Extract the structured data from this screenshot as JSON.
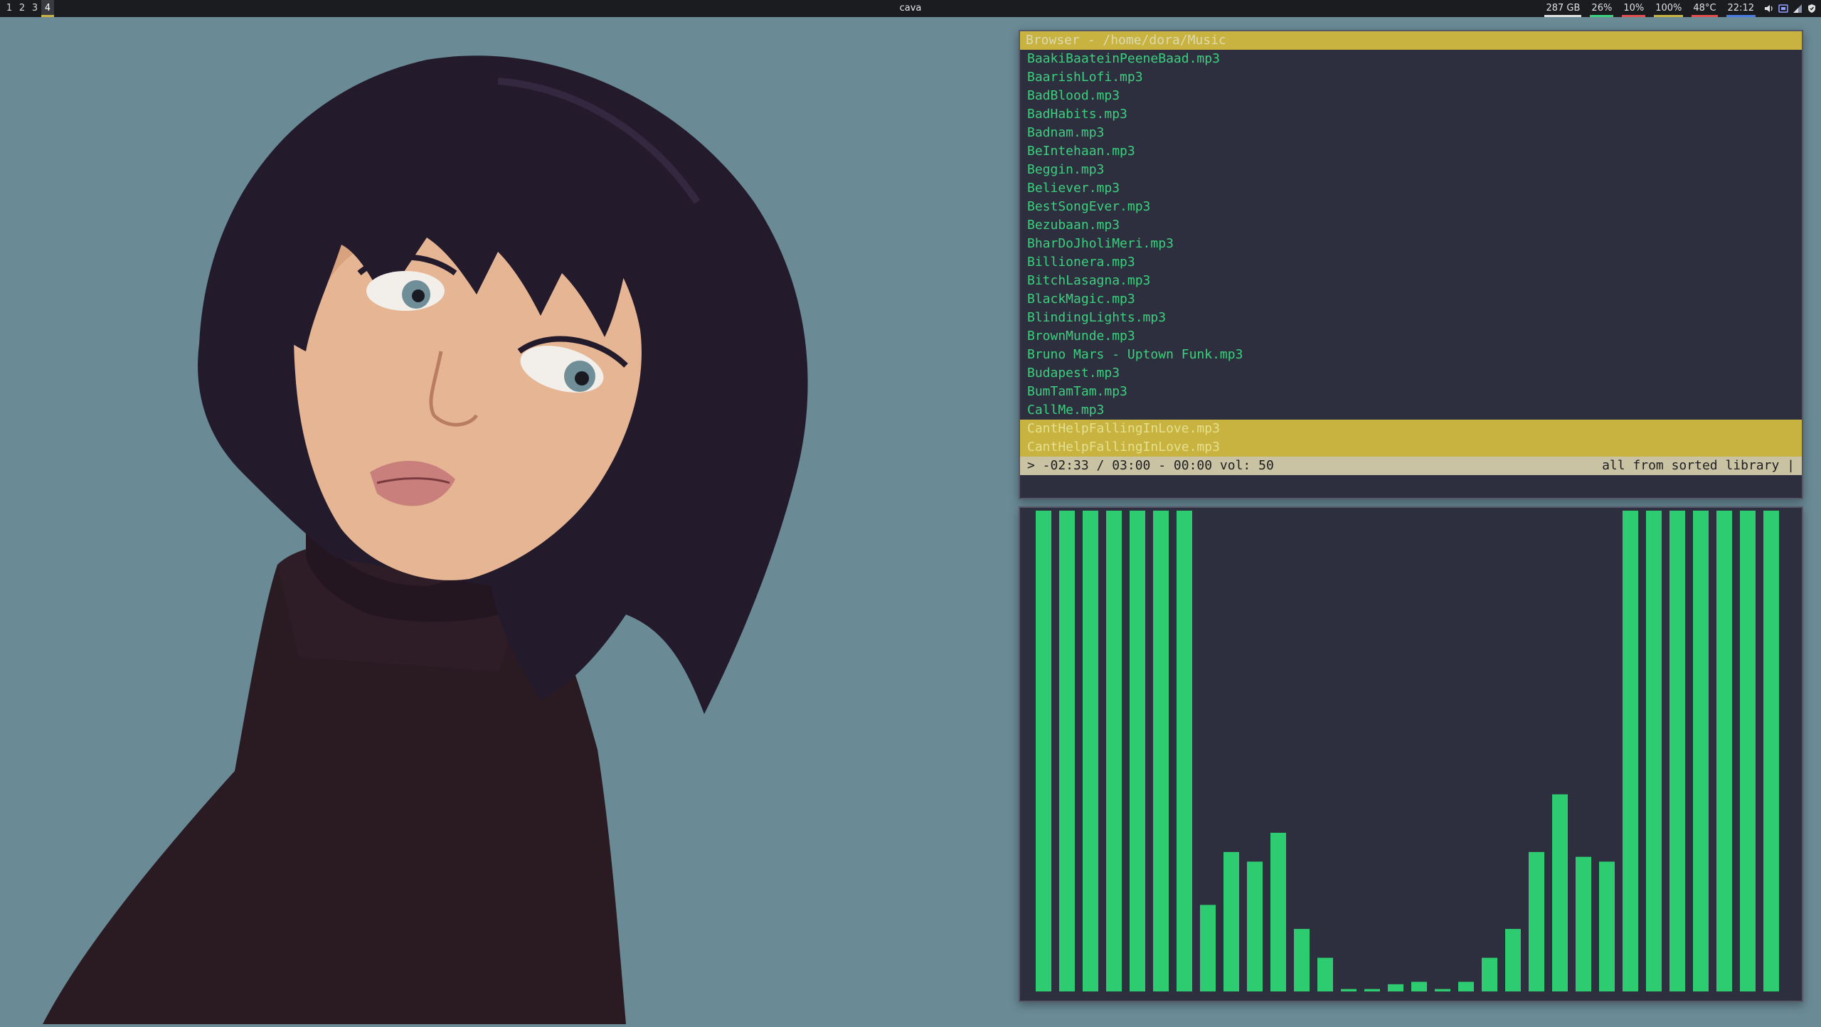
{
  "topbar": {
    "workspaces": [
      "1",
      "2",
      "3",
      "4"
    ],
    "active_workspace": "4",
    "window_title": "cava",
    "status": [
      {
        "label": "287 GB",
        "color": "#e0e0e0"
      },
      {
        "label": "26%",
        "color": "#3bd07e"
      },
      {
        "label": "10%",
        "color": "#e05050"
      },
      {
        "label": "100%",
        "color": "#c8b341"
      },
      {
        "label": "48°C",
        "color": "#e05050"
      },
      {
        "label": "22:12",
        "color": "#4a7be0"
      }
    ],
    "tray_icons": [
      "volume-icon",
      "network-icon",
      "signal-icon",
      "shield-icon"
    ]
  },
  "browser": {
    "title": "Browser - /home/dora/Music",
    "tracks": [
      "BaakiBaateinPeeneBaad.mp3",
      "BaarishLofi.mp3",
      "BadBlood.mp3",
      "BadHabits.mp3",
      "Badnam.mp3",
      "BeIntehaan.mp3",
      "Beggin.mp3",
      "Believer.mp3",
      "BestSongEver.mp3",
      "Bezubaan.mp3",
      "BharDoJholiMeri.mp3",
      "Billionera.mp3",
      "BitchLasagna.mp3",
      "BlackMagic.mp3",
      "BlindingLights.mp3",
      "BrownMunde.mp3",
      "Bruno Mars - Uptown Funk.mp3",
      "Budapest.mp3",
      "BumTamTam.mp3",
      "CallMe.mp3",
      "CantHelpFallingInLove.mp3",
      "CantHelpFallingInLove.mp3"
    ],
    "selected_indices": [
      20,
      21
    ],
    "status_left": "> -02:33 / 03:00 - 00:00 vol: 50",
    "status_right": "all from sorted library |"
  },
  "cava": {
    "bar_color": "#2ecc71",
    "levels": [
      1,
      1,
      1,
      1,
      1,
      1,
      1,
      0.18,
      0.29,
      0.27,
      0.33,
      0.13,
      0.07,
      0.005,
      0.005,
      0.015,
      0.02,
      0.005,
      0.02,
      0.07,
      0.13,
      0.29,
      0.41,
      0.28,
      0.27,
      1,
      1,
      1,
      1,
      1,
      1,
      1
    ]
  }
}
